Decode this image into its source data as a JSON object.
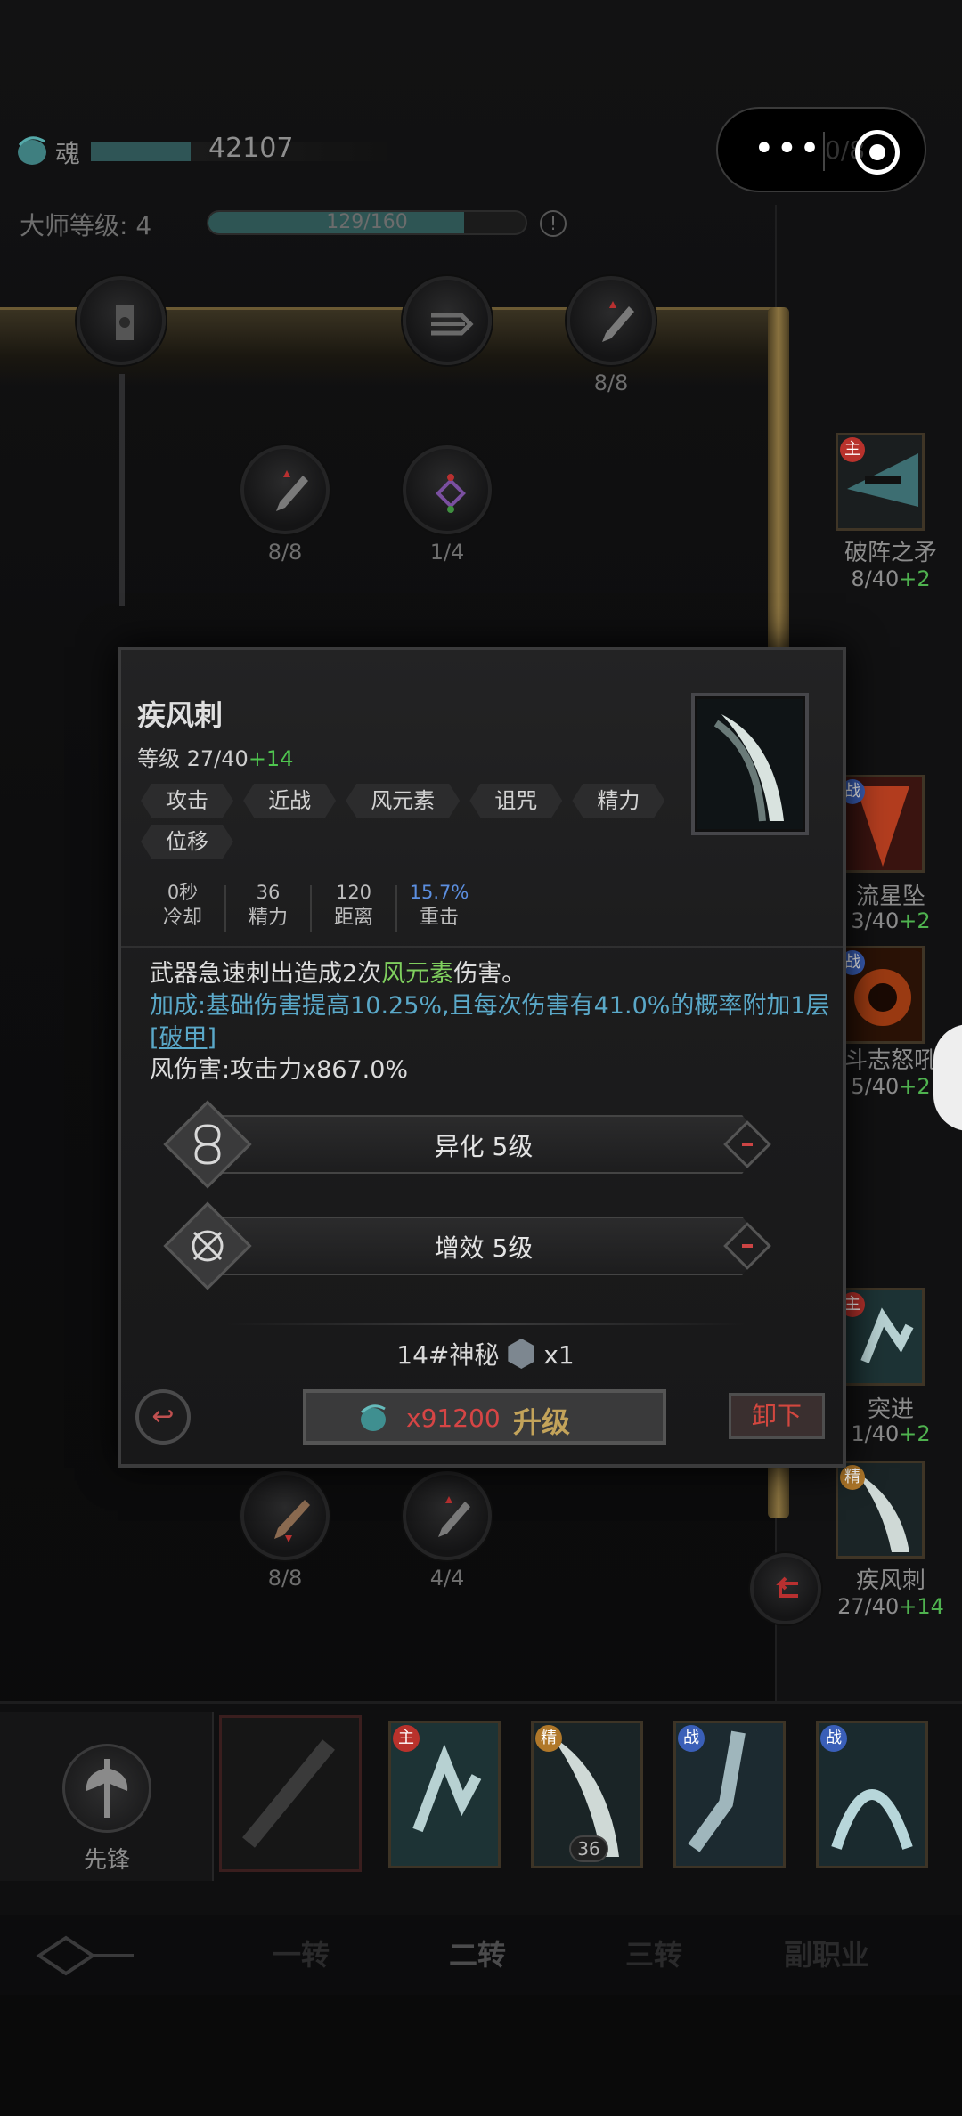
{
  "top": {
    "soul_label": "魂",
    "soul_value": "42107",
    "master_label": "大师等级:",
    "master_level": "4",
    "master_progress_text": "129/160",
    "master_progress_fraction": 0.806,
    "info_icon": "exclamation-icon",
    "capsule_dots": "•••",
    "capsule_faint": "0/8"
  },
  "tree": {
    "counts": [
      "8/8",
      "8/8",
      "1/4",
      "8/8",
      "4/4"
    ]
  },
  "side_skills": [
    {
      "badge": "主",
      "name": "破阵之矛",
      "level": "8/40",
      "plus": "+2"
    },
    {
      "badge": "战",
      "name": "流星坠",
      "level": "3/40",
      "plus": "+2"
    },
    {
      "badge": "战",
      "name": "斗志怒吼",
      "level": "5/40",
      "plus": "+2"
    },
    {
      "badge": "主",
      "name": "突进",
      "level": "1/40",
      "plus": "+2"
    },
    {
      "badge": "精",
      "name": "疾风刺",
      "level": "27/40",
      "plus": "+14"
    }
  ],
  "popup": {
    "title": "疾风刺",
    "level_label": "等级",
    "level_value": "27/40",
    "level_plus": "+14",
    "tags": [
      "攻击",
      "近战",
      "风元素",
      "诅咒",
      "精力",
      "位移"
    ],
    "stats": [
      {
        "value": "0秒",
        "label": "冷却"
      },
      {
        "value": "36",
        "label": "精力"
      },
      {
        "value": "120",
        "label": "距离"
      },
      {
        "value": "15.7%",
        "label": "重击"
      }
    ],
    "desc_main_a": "武器急速刺出造成2次",
    "desc_main_wind": "风元素",
    "desc_main_b": "伤害。",
    "desc_bonus_a": "加成:基础伤害提高10.25%,且每次伤害有41.0%的概率附加1层",
    "desc_bonus_link": "[破甲]",
    "desc_damage": "风伤害:攻击力x867.0%",
    "mods": [
      {
        "name": "异化",
        "level": "5级"
      },
      {
        "name": "增效",
        "level": "5级"
      }
    ],
    "cost_label": "14#神秘",
    "cost_qty": "x1",
    "upgrade_cost": "x91200",
    "upgrade_label": "升级",
    "unequip_label": "卸下"
  },
  "bottom": {
    "pioneer_label": "先锋",
    "slots": [
      {
        "badge": "主",
        "badge_color": "#b8322c"
      },
      {
        "badge": "精",
        "badge_color": "#b0782a",
        "num": "36"
      },
      {
        "badge": "战",
        "badge_color": "#3a5fb8"
      },
      {
        "badge": "战",
        "badge_color": "#3a5fb8"
      }
    ],
    "tabs": [
      "一转",
      "二转",
      "三转",
      "副职业"
    ]
  },
  "colors": {
    "plus_green": "#4fb24f",
    "crit_blue": "#5c8fe0",
    "upgrade_red": "#d64545",
    "gold": "#c3a35a"
  }
}
